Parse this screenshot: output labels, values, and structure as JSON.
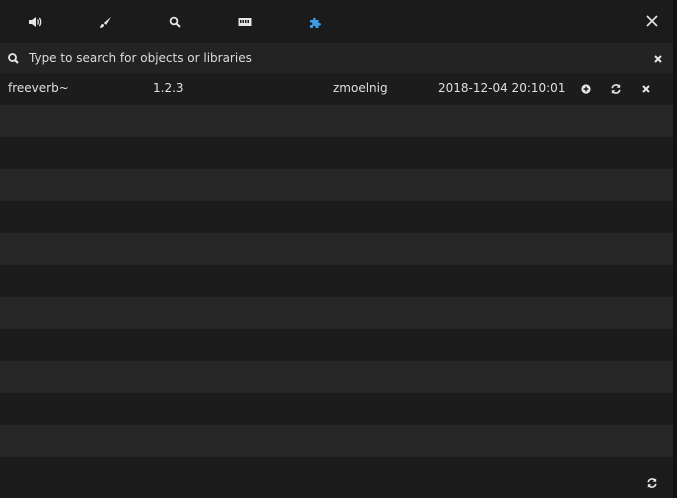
{
  "toolbar": {
    "tabs": [
      {
        "name": "audio",
        "icon": "speaker-icon",
        "active": false
      },
      {
        "name": "appearance",
        "icon": "paintbrush-icon",
        "active": false
      },
      {
        "name": "search",
        "icon": "magnifier-icon",
        "active": false
      },
      {
        "name": "midi",
        "icon": "midi-port-icon",
        "active": false
      },
      {
        "name": "deken",
        "icon": "puzzle-icon",
        "active": true
      }
    ],
    "close_icon": "close-icon",
    "accent_color": "#3d9be0"
  },
  "search": {
    "placeholder": "Type to search for objects or libraries",
    "value": ""
  },
  "packages": [
    {
      "name": "freeverb~",
      "version": "1.2.3",
      "author": "zmoelnig",
      "date": "2018-12-04 20:10:01"
    }
  ]
}
